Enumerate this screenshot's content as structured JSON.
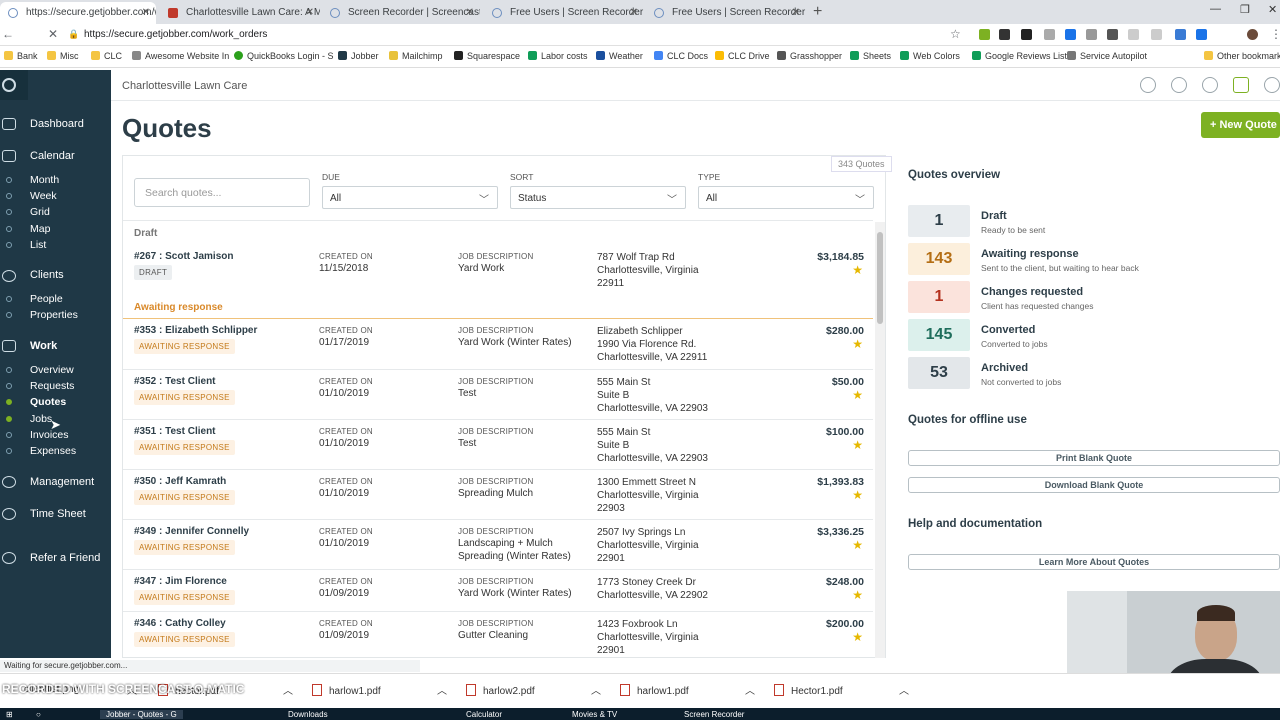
{
  "browser": {
    "tabs": [
      {
        "title": "https://secure.getjobber.com/wo",
        "active": true
      },
      {
        "title": "Charlottesville Lawn Care: A Mo"
      },
      {
        "title": "Screen Recorder | Screencast-O-"
      },
      {
        "title": "Free Users | Screen Recorder & V"
      },
      {
        "title": "Free Users | Screen Recorder & V"
      }
    ],
    "new_tab": "+",
    "url": "https://secure.getjobber.com/work_orders",
    "bookmarks": [
      "Bank",
      "Misc",
      "CLC",
      "Awesome Website In",
      "QuickBooks Login - S",
      "Jobber",
      "Mailchimp",
      "Squarespace",
      "Labor costs",
      "Weather",
      "CLC Docs",
      "CLC Drive",
      "Grasshopper",
      "Sheets",
      "Web Colors",
      "Google Reviews List",
      "Service Autopilot",
      "Other bookmarks"
    ]
  },
  "sidebar": {
    "items": [
      {
        "label": "Dashboard"
      },
      {
        "label": "Calendar",
        "children": [
          "Month",
          "Week",
          "Grid",
          "Map",
          "List"
        ]
      },
      {
        "label": "Clients",
        "children": [
          "People",
          "Properties"
        ]
      },
      {
        "label": "Work",
        "children": [
          "Overview",
          "Requests",
          "Quotes",
          "Jobs",
          "Invoices",
          "Expenses"
        ]
      },
      {
        "label": "Management"
      },
      {
        "label": "Time Sheet"
      },
      {
        "label": "Refer a Friend"
      }
    ]
  },
  "header": {
    "company": "Charlottesville Lawn Care",
    "title": "Quotes",
    "new_button": "+ New Quote"
  },
  "filters": {
    "count": "343 Quotes",
    "search_placeholder": "Search quotes...",
    "due": {
      "label": "DUE",
      "value": "All"
    },
    "sort": {
      "label": "SORT",
      "value": "Status"
    },
    "type": {
      "label": "TYPE",
      "value": "All"
    }
  },
  "groups": {
    "draft": "Draft",
    "awaiting": "Awaiting response"
  },
  "labels": {
    "created": "CREATED ON",
    "job": "JOB DESCRIPTION"
  },
  "quotes": [
    {
      "name": "#267 : Scott Jamison",
      "status": "DRAFT",
      "date": "11/15/2018",
      "job": "Yard Work",
      "addr": [
        "787 Wolf Trap Rd",
        "Charlottesville, Virginia",
        "22911"
      ],
      "amount": "$3,184.85"
    },
    {
      "name": "#353 : Elizabeth Schlipper",
      "status": "AWAITING RESPONSE",
      "date": "01/17/2019",
      "job": "Yard Work (Winter Rates)",
      "addr": [
        "Elizabeth Schlipper",
        "1990 Via Florence Rd.",
        "Charlottesville, VA 22911"
      ],
      "amount": "$280.00"
    },
    {
      "name": "#352 : Test Client",
      "status": "AWAITING RESPONSE",
      "date": "01/10/2019",
      "job": "Test",
      "addr": [
        "555 Main St",
        "Suite B",
        "Charlottesville, VA 22903"
      ],
      "amount": "$50.00"
    },
    {
      "name": "#351 : Test Client",
      "status": "AWAITING RESPONSE",
      "date": "01/10/2019",
      "job": "Test",
      "addr": [
        "555 Main St",
        "Suite B",
        "Charlottesville, VA 22903"
      ],
      "amount": "$100.00"
    },
    {
      "name": "#350 : Jeff Kamrath",
      "status": "AWAITING RESPONSE",
      "date": "01/10/2019",
      "job": "Spreading Mulch",
      "addr": [
        "1300 Emmett Street N",
        "Charlottesville, Virginia",
        "22903"
      ],
      "amount": "$1,393.83"
    },
    {
      "name": "#349 : Jennifer Connelly",
      "status": "AWAITING RESPONSE",
      "date": "01/10/2019",
      "job": "Landscaping + Mulch Spreading (Winter Rates)",
      "addr": [
        "2507 Ivy Springs Ln",
        "Charlottesville, Virginia",
        "22901"
      ],
      "amount": "$3,336.25"
    },
    {
      "name": "#347 : Jim Florence",
      "status": "AWAITING RESPONSE",
      "date": "01/09/2019",
      "job": "Yard Work (Winter Rates)",
      "addr": [
        "1773 Stoney Creek Dr",
        "Charlottesville, VA 22902"
      ],
      "amount": "$248.00"
    },
    {
      "name": "#346 : Cathy Colley",
      "status": "AWAITING RESPONSE",
      "date": "01/09/2019",
      "job": "Gutter Cleaning",
      "addr": [
        "1423 Foxbrook Ln",
        "Charlottesville, Virginia",
        "22901"
      ],
      "amount": "$200.00"
    }
  ],
  "overview": {
    "title": "Quotes overview",
    "stats": [
      {
        "num": "1",
        "label": "Draft",
        "sub": "Ready to be sent",
        "bg": "#e8ecef",
        "fg": "#2d3e48"
      },
      {
        "num": "143",
        "label": "Awaiting response",
        "sub": "Sent to the client, but waiting to hear back",
        "bg": "#fcefdc",
        "fg": "#b46e14"
      },
      {
        "num": "1",
        "label": "Changes requested",
        "sub": "Client has requested changes",
        "bg": "#fbe3dc",
        "fg": "#b4321e"
      },
      {
        "num": "145",
        "label": "Converted",
        "sub": "Converted to jobs",
        "bg": "#dcf0ec",
        "fg": "#1f6e5c"
      },
      {
        "num": "53",
        "label": "Archived",
        "sub": "Not converted to jobs",
        "bg": "#e3e7ea",
        "fg": "#2d3e48"
      }
    ],
    "offline_title": "Quotes for offline use",
    "print": "Print Blank Quote",
    "download": "Download Blank Quote",
    "help_title": "Help and documentation",
    "learn": "Learn More About Quotes"
  },
  "status_bar": "Waiting for secure.getjobber.com...",
  "downloads": [
    "clientlist.png",
    "hector.pdf",
    "harlow1.pdf",
    "harlow2.pdf",
    "harlow1.pdf",
    "Hector1.pdf"
  ],
  "watermark": "RECORDED WITH SCREENCAST-O-MATIC",
  "taskbar": [
    "Jobber - Quotes - G",
    "Downloads",
    "Calculator",
    "Movies & TV",
    "Screen Recorder"
  ]
}
